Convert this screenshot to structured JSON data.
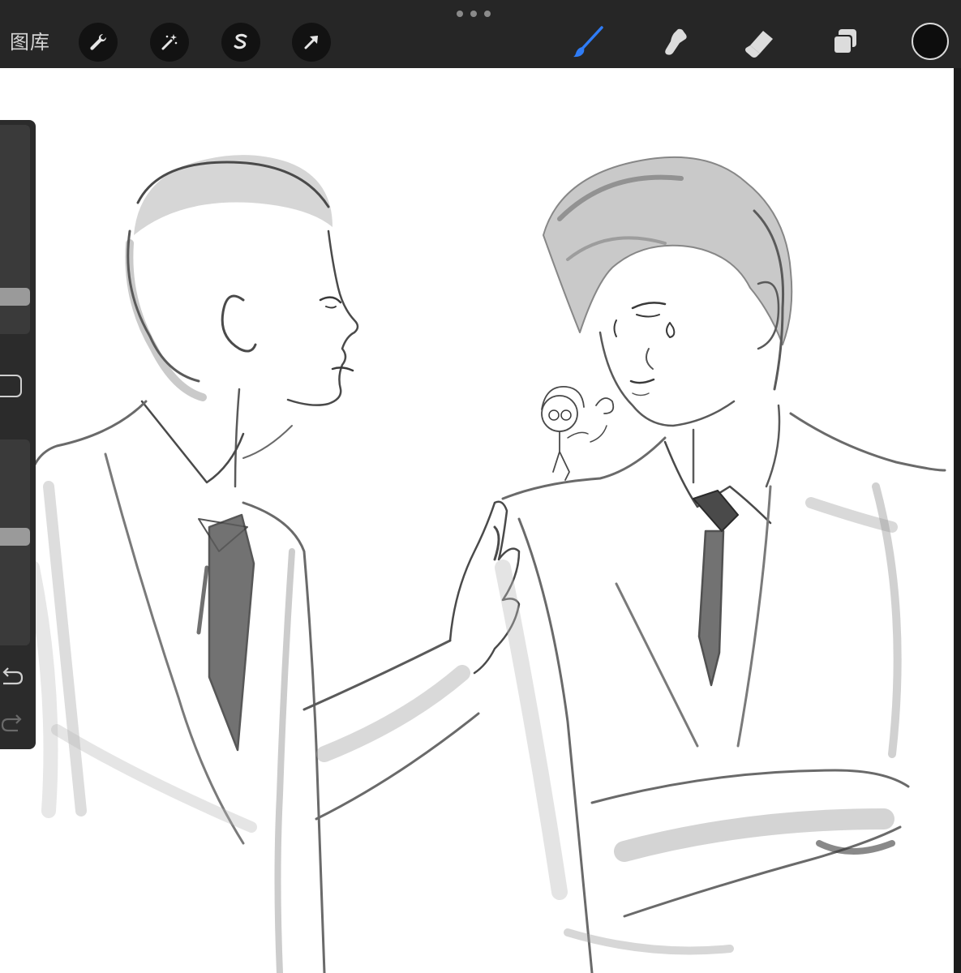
{
  "toolbar": {
    "gallery_label": "图库",
    "left_tools": [
      {
        "name": "actions",
        "icon": "wrench-icon"
      },
      {
        "name": "adjustments",
        "icon": "magic-wand-icon"
      },
      {
        "name": "selection",
        "icon": "selection-s-icon"
      },
      {
        "name": "transform",
        "icon": "arrow-cursor-icon"
      }
    ],
    "right_tools": [
      {
        "name": "brush",
        "icon": "brush-icon",
        "active": true
      },
      {
        "name": "smudge",
        "icon": "smudge-icon",
        "active": false
      },
      {
        "name": "eraser",
        "icon": "eraser-icon",
        "active": false
      },
      {
        "name": "layers",
        "icon": "layers-icon",
        "active": false
      }
    ],
    "active_color": "#0d0d0d",
    "accent_color": "#2f7cf6"
  },
  "sidebar": {
    "brush_size_level": 0.15,
    "opacity_level": 0.53,
    "icons": [
      "square-modify-icon",
      "undo-icon",
      "redo-icon"
    ]
  },
  "canvas": {
    "background": "#ffffff"
  }
}
